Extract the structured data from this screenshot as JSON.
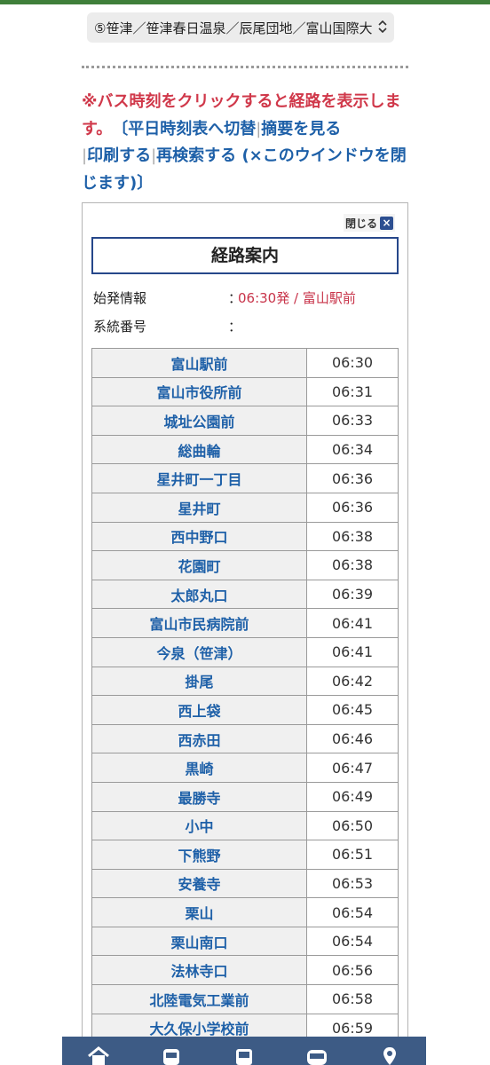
{
  "route_selector": {
    "selected": "⑤笹津／笹津春日温泉／辰尾団地／富山国際大"
  },
  "notice": {
    "warning": "※バス時刻をクリックすると経路を表示します。",
    "bracket_open": "〔",
    "link_weekday": "平日時刻表へ切替",
    "sep1": "|",
    "link_summary": "摘要を見る",
    "sep2": "|",
    "link_print": "印刷する",
    "sep3": "|",
    "link_research": "再検索する",
    "close_note": "(×このウインドウを閉じます)",
    "bracket_close": "〕"
  },
  "panel": {
    "close_label": "閉じる",
    "close_icon": "close-icon",
    "title": "経路案内",
    "origin_label": "始発情報",
    "origin_colon": "：",
    "origin_value": "06:30発 / 富山駅前",
    "route_label": "系統番号",
    "route_colon": "：",
    "route_value": ""
  },
  "stops": [
    {
      "name": "富山駅前",
      "time": "06:30"
    },
    {
      "name": "富山市役所前",
      "time": "06:31"
    },
    {
      "name": "城址公園前",
      "time": "06:33"
    },
    {
      "name": "総曲輪",
      "time": "06:34"
    },
    {
      "name": "星井町一丁目",
      "time": "06:36"
    },
    {
      "name": "星井町",
      "time": "06:36"
    },
    {
      "name": "西中野口",
      "time": "06:38"
    },
    {
      "name": "花園町",
      "time": "06:38"
    },
    {
      "name": "太郎丸口",
      "time": "06:39"
    },
    {
      "name": "富山市民病院前",
      "time": "06:41"
    },
    {
      "name": "今泉（笹津）",
      "time": "06:41"
    },
    {
      "name": "掛尾",
      "time": "06:42"
    },
    {
      "name": "西上袋",
      "time": "06:45"
    },
    {
      "name": "西赤田",
      "time": "06:46"
    },
    {
      "name": "黒崎",
      "time": "06:47"
    },
    {
      "name": "最勝寺",
      "time": "06:49"
    },
    {
      "name": "小中",
      "time": "06:50"
    },
    {
      "name": "下熊野",
      "time": "06:51"
    },
    {
      "name": "安養寺",
      "time": "06:53"
    },
    {
      "name": "栗山",
      "time": "06:54"
    },
    {
      "name": "栗山南口",
      "time": "06:54"
    },
    {
      "name": "法林寺口",
      "time": "06:56"
    },
    {
      "name": "北陸電気工業前",
      "time": "06:58"
    },
    {
      "name": "大久保小学校前",
      "time": "06:59"
    }
  ],
  "bottom_nav": [
    {
      "icon": "home-icon"
    },
    {
      "icon": "bus-front-icon"
    },
    {
      "icon": "bus-icon"
    },
    {
      "icon": "coach-icon"
    },
    {
      "icon": "map-pin-icon"
    }
  ],
  "colors": {
    "accent": "#1e60a8",
    "warning": "#d0384a",
    "nav_bg": "#3d5b85",
    "top_bar": "#3f7f3a"
  }
}
